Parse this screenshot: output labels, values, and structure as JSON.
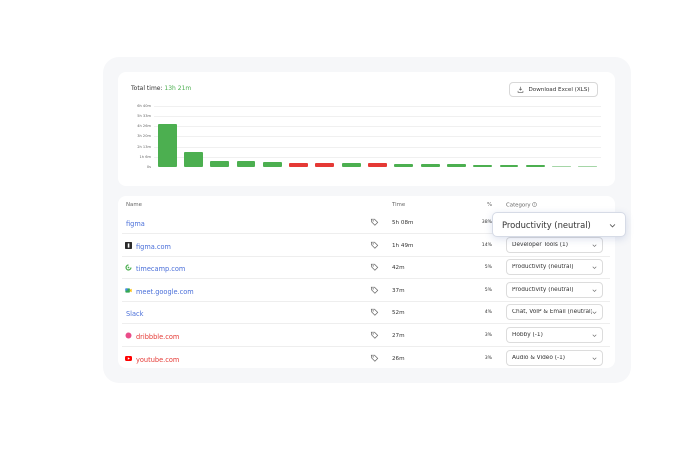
{
  "summary": {
    "total_label": "Total time:",
    "total_value": "13h 21m"
  },
  "toolbar": {
    "download_label": "Download Excel (XLS)"
  },
  "chart_data": {
    "type": "bar",
    "y_ticks": [
      "6h 40m",
      "5h 33m",
      "4h 26m",
      "3h 20m",
      "2h 13m",
      "1h 6m",
      "0s"
    ],
    "ylim_seconds": [
      0,
      24000
    ],
    "values_seconds": [
      16680,
      5940,
      2520,
      2220,
      1920,
      1620,
      1560,
      1440,
      1380,
      1260,
      1080,
      1020,
      900,
      780,
      660,
      360,
      300
    ],
    "colors": [
      "#4caf50",
      "#4caf50",
      "#4caf50",
      "#4caf50",
      "#4caf50",
      "#e53935",
      "#e53935",
      "#4caf50",
      "#e53935",
      "#4caf50",
      "#4caf50",
      "#4caf50",
      "#4caf50",
      "#4caf50",
      "#4caf50",
      "#a5d6a7",
      "#a5d6a7"
    ],
    "grid": true,
    "legend": "none"
  },
  "table": {
    "headers": {
      "name": "Name",
      "time": "Time",
      "pct": "%",
      "category": "Category"
    },
    "rows": [
      {
        "name": "figma",
        "name_color": "#4a6fd9",
        "icon": "none",
        "time": "5h 08m",
        "pct": "38%",
        "category": "Productivity (neutral)"
      },
      {
        "name": "figma.com",
        "name_color": "#4a6fd9",
        "icon": "figma-favicon-icon",
        "time": "1h 49m",
        "pct": "14%",
        "category": "Developer Tools (1)"
      },
      {
        "name": "timecamp.com",
        "name_color": "#4a6fd9",
        "icon": "timecamp-favicon-icon",
        "time": "42m",
        "pct": "5%",
        "category": "Productivity (neutral)"
      },
      {
        "name": "meet.google.com",
        "name_color": "#4a6fd9",
        "icon": "google-meet-favicon-icon",
        "time": "37m",
        "pct": "5%",
        "category": "Productivity (neutral)"
      },
      {
        "name": "Slack",
        "name_color": "#4a6fd9",
        "icon": "none",
        "time": "52m",
        "pct": "4%",
        "category": "Chat, VoIP & Email (neutral)"
      },
      {
        "name": "dribbble.com",
        "name_color": "#e53935",
        "icon": "dribbble-favicon-icon",
        "time": "27m",
        "pct": "3%",
        "category": "Hobby (-1)"
      },
      {
        "name": "youtube.com",
        "name_color": "#e53935",
        "icon": "youtube-favicon-icon",
        "time": "26m",
        "pct": "3%",
        "category": "Audio & Video (-1)"
      }
    ]
  },
  "popup": {
    "value": "Productivity (neutral)"
  }
}
